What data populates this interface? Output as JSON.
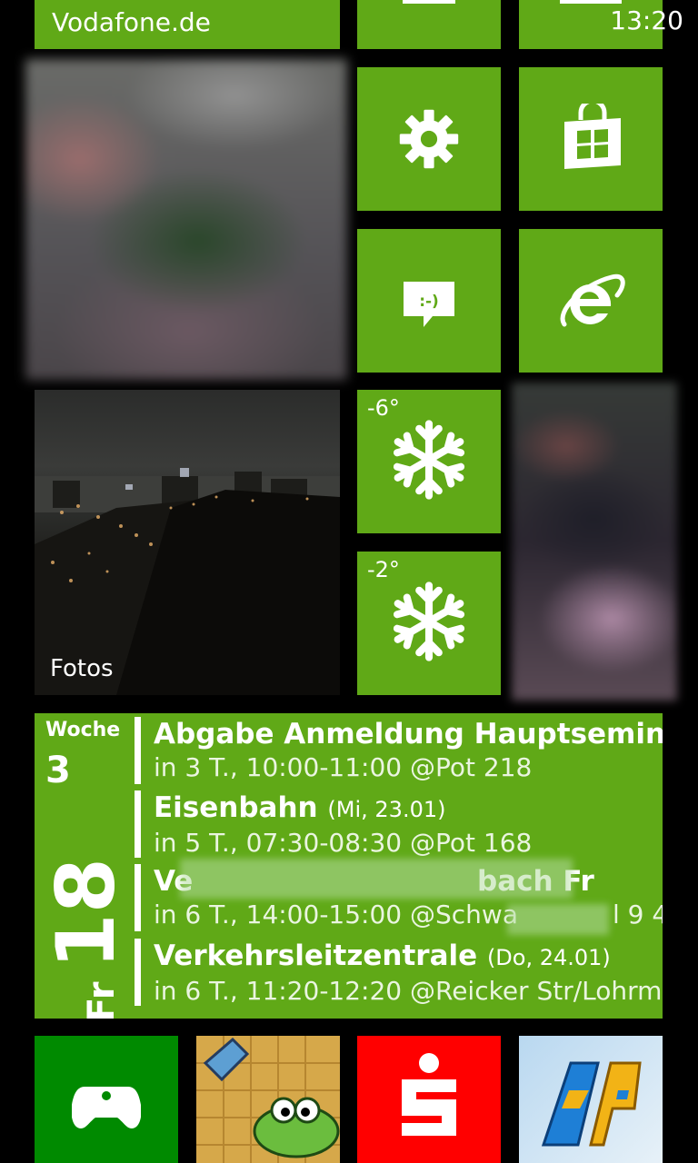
{
  "status": {
    "time": "13:20"
  },
  "tiles": {
    "vodafone": {
      "label": "Vodafone.de"
    },
    "fotos": {
      "label": "Fotos"
    },
    "weather1": {
      "temp": "-6°"
    },
    "weather2": {
      "temp": "-2°"
    }
  },
  "calendar": {
    "week_label": "Woche",
    "week_number": "3",
    "day_name": "Fr",
    "day_number": "18",
    "events": [
      {
        "title": "Abgabe Anmeldung Hauptsemin",
        "date": "",
        "detail": "in 3 T., 10:00-11:00 @Pot 218"
      },
      {
        "title": "Eisenbahn",
        "date": "(Mi, 23.01)",
        "detail": "in 5 T., 07:30-08:30 @Pot 168"
      },
      {
        "title": "Ve",
        "title_end": "bach Fr",
        "date": "",
        "detail": "in 6 T., 14:00-15:00 @Schwa",
        "detail_end": "l 9 4"
      },
      {
        "title": "Verkehrsleitzentrale",
        "date": "(Do, 24.01)",
        "detail": "in 6 T., 11:20-12:20 @Reicker Str/Lohrm"
      }
    ]
  },
  "colors": {
    "accent": "#60a917",
    "xbox": "#008a00",
    "sparkasse": "#ff0000"
  },
  "icons": [
    "settings-icon",
    "store-icon",
    "messaging-icon",
    "internet-explorer-icon",
    "snowflake-icon",
    "xbox-controller-icon",
    "sparkasse-icon",
    "game-logo-icon"
  ]
}
